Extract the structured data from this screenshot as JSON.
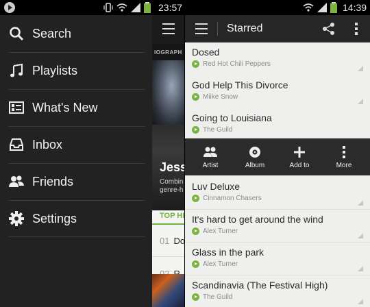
{
  "left_phone": {
    "status": {
      "time": "23:57"
    },
    "menu": [
      {
        "label": "Search",
        "icon": "search-icon"
      },
      {
        "label": "Playlists",
        "icon": "music-note-icon"
      },
      {
        "label": "What's New",
        "icon": "news-icon"
      },
      {
        "label": "Inbox",
        "icon": "inbox-icon"
      },
      {
        "label": "Friends",
        "icon": "friends-icon"
      },
      {
        "label": "Settings",
        "icon": "gear-icon"
      }
    ],
    "background_app": {
      "tab_label": "IOGRAPH",
      "artist_name": "Jess",
      "desc_line1": "Combin",
      "desc_line2": "genre-h",
      "section_label": "TOP HI",
      "rows": [
        {
          "num": "01",
          "text": "Do"
        },
        {
          "num": "02",
          "text": "R"
        }
      ]
    }
  },
  "right_phone": {
    "status": {
      "time": "14:39"
    },
    "title": "Starred",
    "tracks_top": [
      {
        "title": "Dosed",
        "artist": "Red Hot Chili Peppers"
      },
      {
        "title": "God Help This Divorce",
        "artist": "Miike Snow"
      },
      {
        "title": "Going to Louisiana",
        "artist": "The Guild"
      }
    ],
    "context_actions": [
      {
        "label": "Artist",
        "icon": "artist-icon"
      },
      {
        "label": "Album",
        "icon": "album-icon"
      },
      {
        "label": "Add to",
        "icon": "plus-icon"
      },
      {
        "label": "More",
        "icon": "more-vertical-icon"
      }
    ],
    "tracks_bottom": [
      {
        "title": "Luv Deluxe",
        "artist": "Cinnamon Chasers"
      },
      {
        "title": "It's hard to get around the wind",
        "artist": "Alex Turner"
      },
      {
        "title": "Glass in the park",
        "artist": "Alex Turner"
      },
      {
        "title": "Scandinavia (The Festival High)",
        "artist": "The Guild"
      }
    ]
  },
  "colors": {
    "accent": "#7cb342",
    "actionbar": "#262626",
    "list_bg": "#efefed",
    "drawer_bg": "#222222"
  }
}
